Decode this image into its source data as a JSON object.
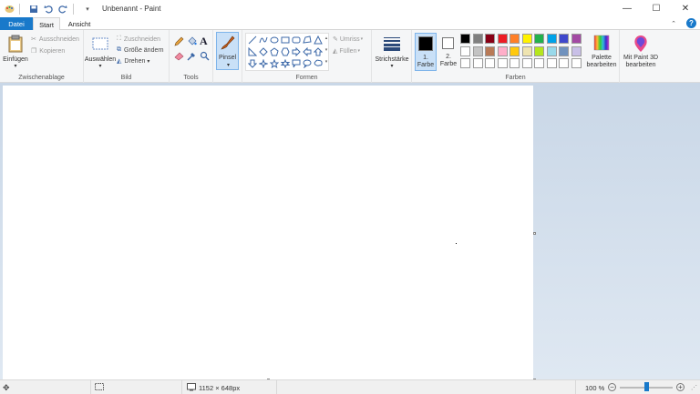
{
  "window": {
    "title": "Unbenannt - Paint",
    "minimize": "—",
    "maximize": "☐",
    "close": "✕"
  },
  "tabs": {
    "file": "Datei",
    "home": "Start",
    "view": "Ansicht"
  },
  "ribbon": {
    "clipboard": {
      "label": "Zwischenablage",
      "paste": "Einfügen",
      "cut": "Ausschneiden",
      "copy": "Kopieren"
    },
    "image": {
      "label": "Bild",
      "select": "Auswählen",
      "crop": "Zuschneiden",
      "resize": "Größe ändern",
      "rotate": "Drehen"
    },
    "tools": {
      "label": "Tools"
    },
    "brushes": {
      "label": "Pinsel"
    },
    "shapes": {
      "label": "Formen",
      "outline": "Umriss",
      "fill": "Füllen"
    },
    "size": {
      "label": "Strichstärke"
    },
    "colors": {
      "label": "Farben",
      "color1": "1.\nFarbe",
      "color1_line1": "1.",
      "color1_line2": "Farbe",
      "color2_line1": "2.",
      "color2_line2": "Farbe",
      "edit_palette_line1": "Palette",
      "edit_palette_line2": "bearbeiten",
      "color1_value": "#000000",
      "color2_value": "#ffffff",
      "palette_row1": [
        "#000000",
        "#7f7f7f",
        "#880015",
        "#ed1c24",
        "#ff7f27",
        "#fff200",
        "#22b14c",
        "#00a2e8",
        "#3f48cc",
        "#a349a4"
      ],
      "palette_row2": [
        "#ffffff",
        "#c3c3c3",
        "#b97a57",
        "#ffaec9",
        "#ffc90e",
        "#efe4b0",
        "#b5e61d",
        "#99d9ea",
        "#7092be",
        "#c8bfe7"
      ],
      "palette_row3": [
        "#ffffff",
        "#ffffff",
        "#ffffff",
        "#ffffff",
        "#ffffff",
        "#ffffff",
        "#ffffff",
        "#ffffff",
        "#ffffff",
        "#ffffff"
      ]
    },
    "paint3d": {
      "line1": "Mit Paint 3D",
      "line2": "bearbeiten"
    }
  },
  "status": {
    "image_size": "1152 × 648px",
    "zoom": "100 %",
    "zoom_percent": 100
  }
}
